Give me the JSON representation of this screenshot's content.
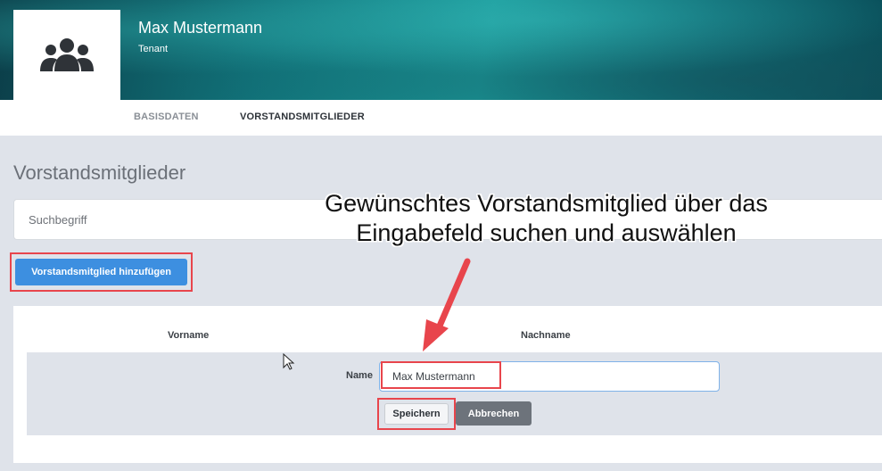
{
  "header": {
    "name": "Max Mustermann",
    "role": "Tenant",
    "avatar_icon": "users-group-icon"
  },
  "tabs": [
    {
      "label": "BASISDATEN",
      "active": false
    },
    {
      "label": "VORSTANDSMITGLIEDER",
      "active": true
    }
  ],
  "section": {
    "title": "Vorstandsmitglieder",
    "search_placeholder": "Suchbegriff",
    "add_button_label": "Vorstandsmitglied hinzufügen"
  },
  "table": {
    "columns": [
      "Vorname",
      "Nachname"
    ],
    "edit_row": {
      "name_label": "Name",
      "name_value": "Max Mustermann",
      "save_label": "Speichern",
      "cancel_label": "Abbrechen"
    }
  },
  "annotation": {
    "line1": "Gewünschtes Vorstandsmitglied über das",
    "line2": "Eingabefeld suchen und auswählen"
  },
  "colors": {
    "accent_blue": "#3d8fe0",
    "highlight_red": "#e8454c",
    "cancel_gray": "#6d737b"
  }
}
